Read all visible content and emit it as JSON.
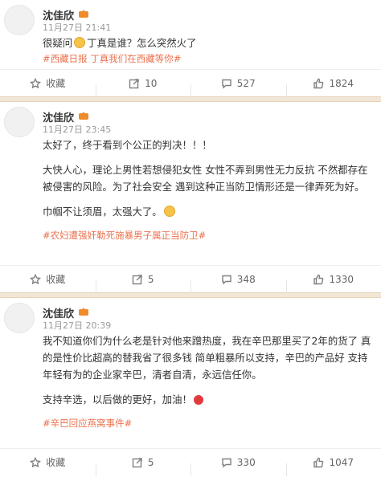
{
  "posts": [
    {
      "user": "沈佳欣",
      "time": "11月27日 21:41",
      "lines": [
        "很疑问",
        "丁真是谁？怎么突然火了"
      ],
      "tag": "#西藏日报 丁真我们在西藏等你#",
      "actions": {
        "fav": "收藏",
        "repost": "10",
        "comment": "527",
        "like": "1824"
      }
    },
    {
      "user": "沈佳欣",
      "time": "11月27日 23:45",
      "line1": "太好了，终于看到个公正的判决！！！",
      "line2": "大快人心，理论上男性若想侵犯女性 女性不弄到男性无力反抗 不然都存在被侵害的风险。为了社会安全 遇到这种正当防卫情形还是一律弄死为好。",
      "line3": "巾帼不让须眉，太强大了。",
      "tag": "#农妇遭强奸勒死施暴男子属正当防卫#",
      "actions": {
        "fav": "收藏",
        "repost": "5",
        "comment": "348",
        "like": "1330"
      }
    },
    {
      "user": "沈佳欣",
      "time": "11月27日 20:39",
      "line1": "我不知道你们为什么老是针对他来蹭热度，我在辛巴那里买了2年的货了 真的是性价比超高的替我省了很多钱 简单粗暴所以支持，辛巴的产品好 支持年轻有为的企业家辛巴，清者自清，永远信任你。",
      "line2": "支持辛选，以后做的更好，加油！",
      "tag": "#辛巴回应燕窝事件#",
      "actions": {
        "fav": "收藏",
        "repost": "5",
        "comment": "330",
        "like": "1047"
      }
    }
  ]
}
